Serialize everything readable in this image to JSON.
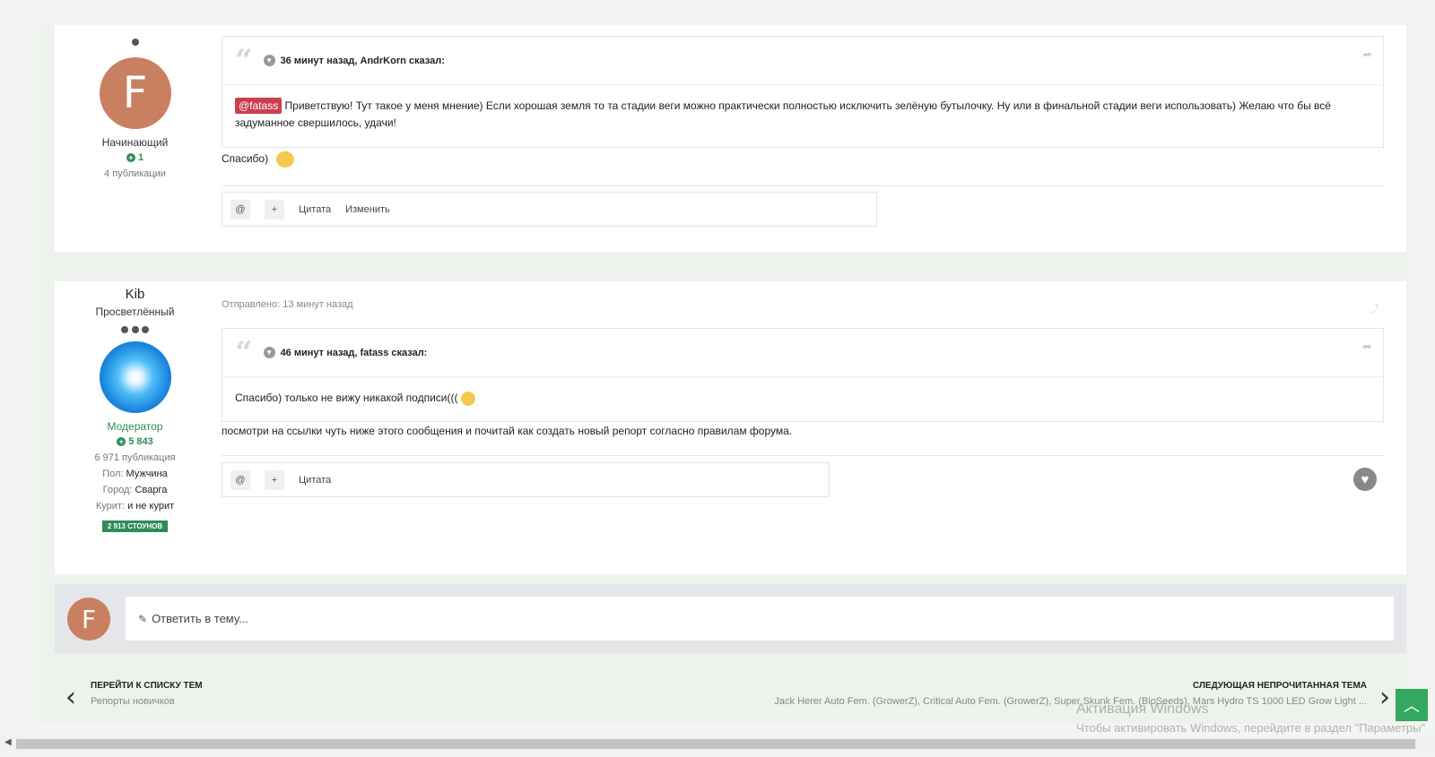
{
  "post1": {
    "rank_title": "Начинающий",
    "avatar_letter": "F",
    "reputation": "1",
    "posts": "4 публикации",
    "quote_header": "36 минут назад, AndrKorn сказал:",
    "mention": "@fatass",
    "quote_text": "Приветствую! Тут такое у меня мнение) Если хорошая земля то та стадии веги можно практически полностью исключить зелёную бутылочку. Ну или в финальной стадии веги использовать) Желаю что бы всё задуманное свершилось, удачи!",
    "reply_text": "Спасибо)",
    "actions": {
      "quote": "Цитата",
      "edit": "Изменить"
    }
  },
  "post2": {
    "username": "Kib",
    "rank_title": "Просветлённый",
    "group": "Модератор",
    "reputation": "5 843",
    "posts": "6 971 публикация",
    "gender_label": "Пол:",
    "gender": "Мужчина",
    "city_label": "Город:",
    "city": "Сварга",
    "smoke_label": "Курит:",
    "smoke": "и не курит",
    "badge": "2 913 СТОУНОВ",
    "sent": "Отправлено: 13 минут назад",
    "quote_header": "46 минут назад, fatass сказал:",
    "quote_text": "Спасибо)  только не вижу никакой подписи(((",
    "reply_text": "посмотри на ссылки чуть ниже этого сообщения и почитай как создать новый репорт согласно правилам форума.",
    "actions": {
      "quote": "Цитата"
    }
  },
  "reply_box": {
    "avatar_letter": "F",
    "placeholder": "Ответить в тему..."
  },
  "nav": {
    "prev_title": "ПЕРЕЙТИ К СПИСКУ ТЕМ",
    "prev_sub": "Репорты новичков",
    "next_title": "СЛЕДУЮЩАЯ НЕПРОЧИТАННАЯ ТЕМА",
    "next_sub": "Jack Herer Auto Fem. (GrowerZ), Critical Auto Fem. (GrowerZ), Super Skunk Fem. (BioSeeds), Mars Hydro TS 1000 LED Grow Light ..."
  },
  "watermark": {
    "line1": "Активация Windows",
    "line2": "Чтобы активировать Windows, перейдите в раздел \"Параметры\""
  },
  "icons": [
    "quote-icon",
    "chevron-down-icon",
    "share-icon",
    "at-icon",
    "plus-icon",
    "heart-icon",
    "pencil-icon",
    "chevron-left-icon",
    "chevron-right-icon",
    "chevron-up-icon"
  ],
  "colors": {
    "accent": "#33a860",
    "mention": "#cc3f4f",
    "reputation": "#2e8b57"
  }
}
